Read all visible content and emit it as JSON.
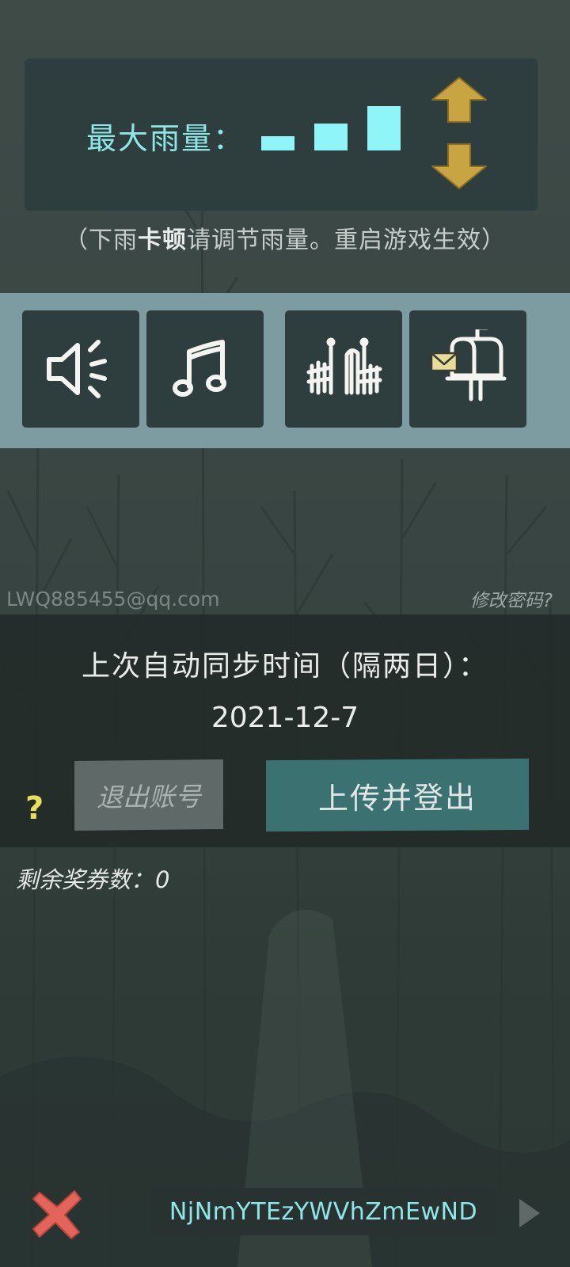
{
  "rain": {
    "label": "最大雨量：",
    "level": 3,
    "level_max": 3,
    "note_prefix": "（下雨",
    "note_bold": "卡顿",
    "note_suffix": "请调节雨量。重启游戏生效）"
  },
  "toolbar": {
    "items": [
      {
        "icon": "speaker-icon"
      },
      {
        "icon": "music-note-icon"
      },
      {
        "icon": "fence-gate-icon"
      },
      {
        "icon": "mailbox-icon"
      }
    ]
  },
  "account": {
    "email": "LWQ885455@qq.com",
    "change_password": "修改密码?"
  },
  "sync": {
    "title": "上次自动同步时间（隔两日）：",
    "date": "2021-12-7",
    "help": "?",
    "logout_label": "退出账号",
    "upload_label": "上传并登出"
  },
  "tickets": {
    "label": "剩余奖券数：",
    "count": "0"
  },
  "footer": {
    "code": "NjNmYTEzYWVhZmEwND"
  },
  "colors": {
    "accent_cyan": "#8ff5f8",
    "arrow_gold": "#c9a443",
    "upload_teal": "#3b7271",
    "close_red": "#e2645b"
  }
}
